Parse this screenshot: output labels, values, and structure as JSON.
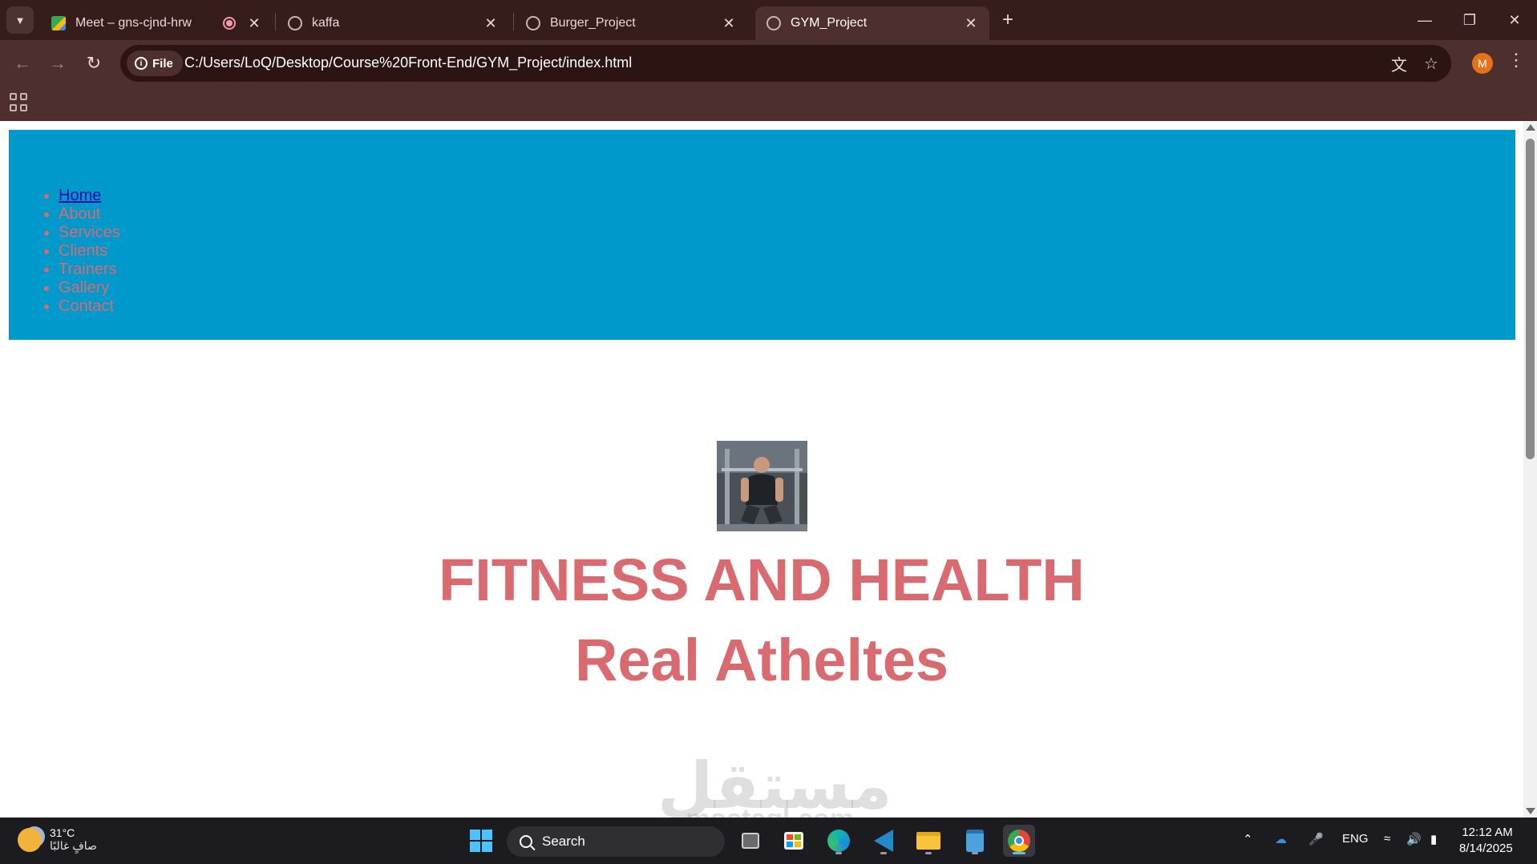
{
  "browser": {
    "tabs": [
      {
        "title": "Meet – gns-cjnd-hrw",
        "active": false,
        "recording": true
      },
      {
        "title": "kaffa",
        "active": false
      },
      {
        "title": "Burger_Project",
        "active": false
      },
      {
        "title": "GYM_Project",
        "active": true
      }
    ],
    "address": {
      "chip_label": "File",
      "url": "C:/Users/LoQ/Desktop/Course%20Front-End/GYM_Project/index.html"
    },
    "profile_initial": "M",
    "icons": [
      "tab-search-icon",
      "close-icon",
      "new-tab-icon",
      "minimize-icon",
      "restore-icon",
      "back-icon",
      "forward-icon",
      "reload-icon",
      "info-icon",
      "translate-icon",
      "star-icon",
      "menu-icon",
      "apps-icon"
    ]
  },
  "page": {
    "nav": [
      "Home",
      "About",
      "Services",
      "Clients",
      "Trainers",
      "Gallery",
      "Contact"
    ],
    "nav_current": "Home",
    "heading": "FITNESS AND HEALTH",
    "subheading": "Real Atheltes",
    "header_color": "#0099cc",
    "accent_color": "#d96a70"
  },
  "watermark": {
    "arabic": "مستقل",
    "latin": "mostaql.com"
  },
  "taskbar": {
    "weather": {
      "temp": "31°C",
      "condition": "صافٍ غالبًا"
    },
    "search_label": "Search",
    "language": "ENG",
    "time": "12:12 AM",
    "date": "8/14/2025"
  }
}
